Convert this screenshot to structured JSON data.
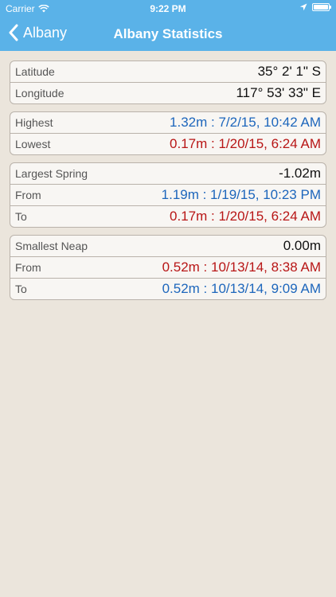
{
  "status": {
    "carrier": "Carrier",
    "time": "9:22 PM"
  },
  "nav": {
    "back_label": "Albany",
    "title": "Albany Statistics"
  },
  "location": {
    "latitude_label": "Latitude",
    "latitude_value": "35° 2' 1\" S",
    "longitude_label": "Longitude",
    "longitude_value": "117° 53' 33\" E"
  },
  "extremes": {
    "highest_label": "Highest",
    "highest_value": "1.32m : 7/2/15, 10:42 AM",
    "lowest_label": "Lowest",
    "lowest_value": "0.17m : 1/20/15, 6:24 AM"
  },
  "largest_spring": {
    "label": "Largest Spring",
    "value": "-1.02m",
    "from_label": "From",
    "from_value": "1.19m : 1/19/15, 10:23 PM",
    "to_label": "To",
    "to_value": "0.17m : 1/20/15, 6:24 AM"
  },
  "smallest_neap": {
    "label": "Smallest Neap",
    "value": "0.00m",
    "from_label": "From",
    "from_value": "0.52m : 10/13/14, 8:38 AM",
    "to_label": "To",
    "to_value": "0.52m : 10/13/14, 9:09 AM"
  },
  "colors": {
    "header": "#5ab2e8",
    "background": "#ebe5dc",
    "high_value": "#1d66bc",
    "low_value": "#b81616"
  }
}
